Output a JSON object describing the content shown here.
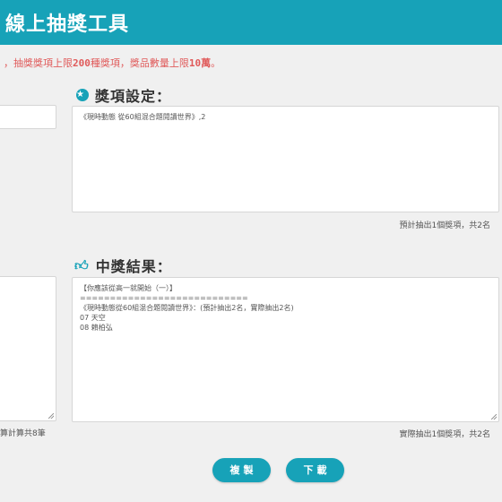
{
  "app": {
    "title": "線上抽獎工具"
  },
  "notice": {
    "prefix": "，抽獎獎項上限",
    "max_prizes": "200",
    "middle": "種獎項，獎品數量上限",
    "max_quantity": "10萬",
    "suffix": "。"
  },
  "prize_settings": {
    "title": "獎項設定：",
    "value": "《現時動態 從60組混合題閱讀世界》,2",
    "estimate": "預計抽出1個獎項，共2名"
  },
  "left_panel": {
    "count_text": "算計算共8筆"
  },
  "results": {
    "title": "中獎結果：",
    "lines": [
      "【你應該從高一就開始（一）】",
      "============================",
      "《現時動態從60組混合題閱讀世界》：(預計抽出2名，實際抽出2名)",
      "07 天空",
      "08 賴柏弘"
    ],
    "actual": "實際抽出1個獎項，共2名"
  },
  "actions": {
    "copy_label": "複製",
    "download_label": "下載"
  },
  "colors": {
    "accent": "#17a2b8",
    "notice": "#e05a5a",
    "background": "#f0f0f0"
  },
  "icons": {
    "prize_icon": "star-icon",
    "result_icon": "thumbs-up-icon"
  }
}
